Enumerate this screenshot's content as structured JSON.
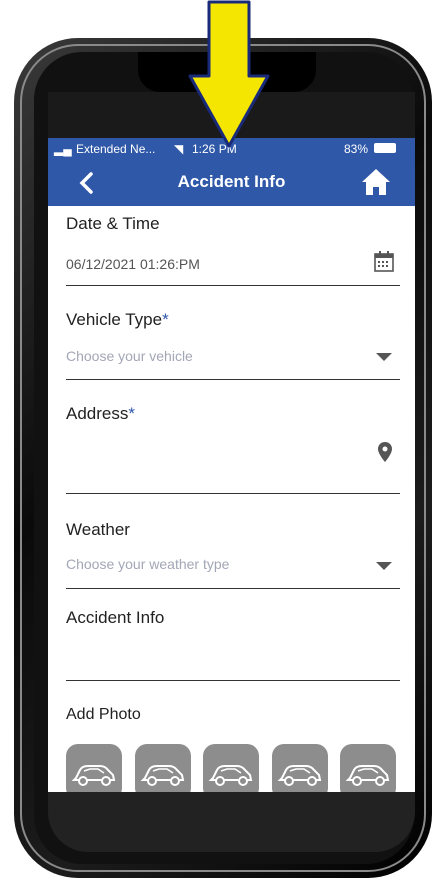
{
  "status": {
    "carrier": "Extended Ne...",
    "time": "1:26 PM",
    "battery": "83%"
  },
  "header": {
    "title": "Accident Info"
  },
  "form": {
    "date_label": "Date & Time",
    "date_value": "06/12/2021 01:26:PM",
    "vehicle_label": "Vehicle Type",
    "vehicle_placeholder": "Choose your vehicle",
    "address_label": "Address",
    "weather_label": "Weather",
    "weather_placeholder": "Choose your weather type",
    "info_label": "Accident Info",
    "photo_label": "Add Photo",
    "required_mark": "*"
  },
  "photos": [
    "car-icon",
    "car-icon",
    "car-icon",
    "car-icon",
    "car-icon"
  ],
  "colors": {
    "brand": "#2f58a8",
    "arrow": "#f4e600"
  }
}
